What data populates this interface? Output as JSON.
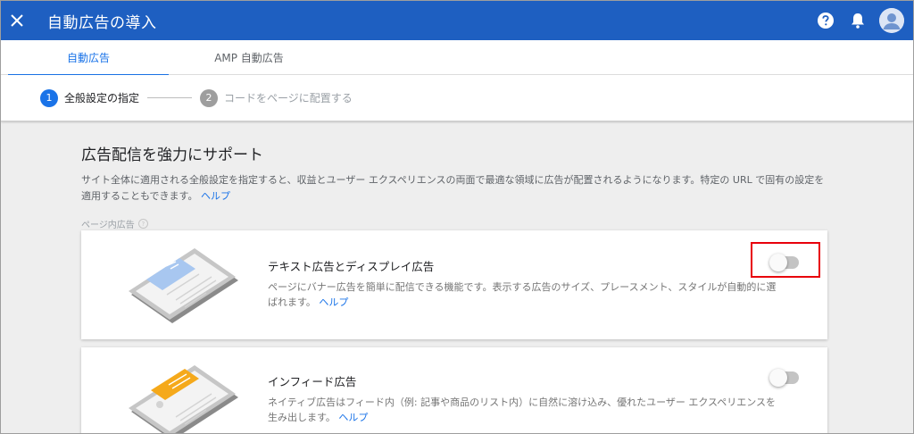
{
  "appbar": {
    "title": "自動広告の導入",
    "icons": [
      "close-icon",
      "help-icon",
      "bell-icon",
      "avatar"
    ],
    "color": "#1e5fc1"
  },
  "tabs": [
    {
      "label": "自動広告",
      "active": true
    },
    {
      "label": "AMP 自動広告",
      "active": false
    }
  ],
  "stepper": {
    "steps": [
      {
        "num": "1",
        "label": "全般設定の指定",
        "active": true
      },
      {
        "num": "2",
        "label": "コードをページに配置する",
        "active": false
      }
    ]
  },
  "main": {
    "heading": "広告配信を強力にサポート",
    "description": "サイト全体に適用される全般設定を指定すると、収益とユーザー エクスペリエンスの両面で最適な領域に広告が配置されるようになります。特定の URL で固有の設定を適用することもできます。",
    "help_link": "ヘルプ",
    "section_label": "ページ内広告",
    "section_help": "?"
  },
  "cards": [
    {
      "title": "テキスト広告とディスプレイ広告",
      "description": "ページにバナー広告を簡単に配信できる機能です。表示する広告のサイズ、プレースメント、スタイルが自動的に選ばれます。",
      "help_link": "ヘルプ",
      "enabled": false
    },
    {
      "title": "インフィード広告",
      "description": "ネイティブ広告はフィード内（例: 記事や商品のリスト内）に自然に溶け込み、優れたユーザー エクスペリエンスを生み出します。",
      "help_link": "ヘルプ",
      "enabled": false
    }
  ],
  "colors": {
    "accent": "#1a73e8",
    "step_inactive": "#9e9e9e",
    "highlight": "#e8000b"
  }
}
